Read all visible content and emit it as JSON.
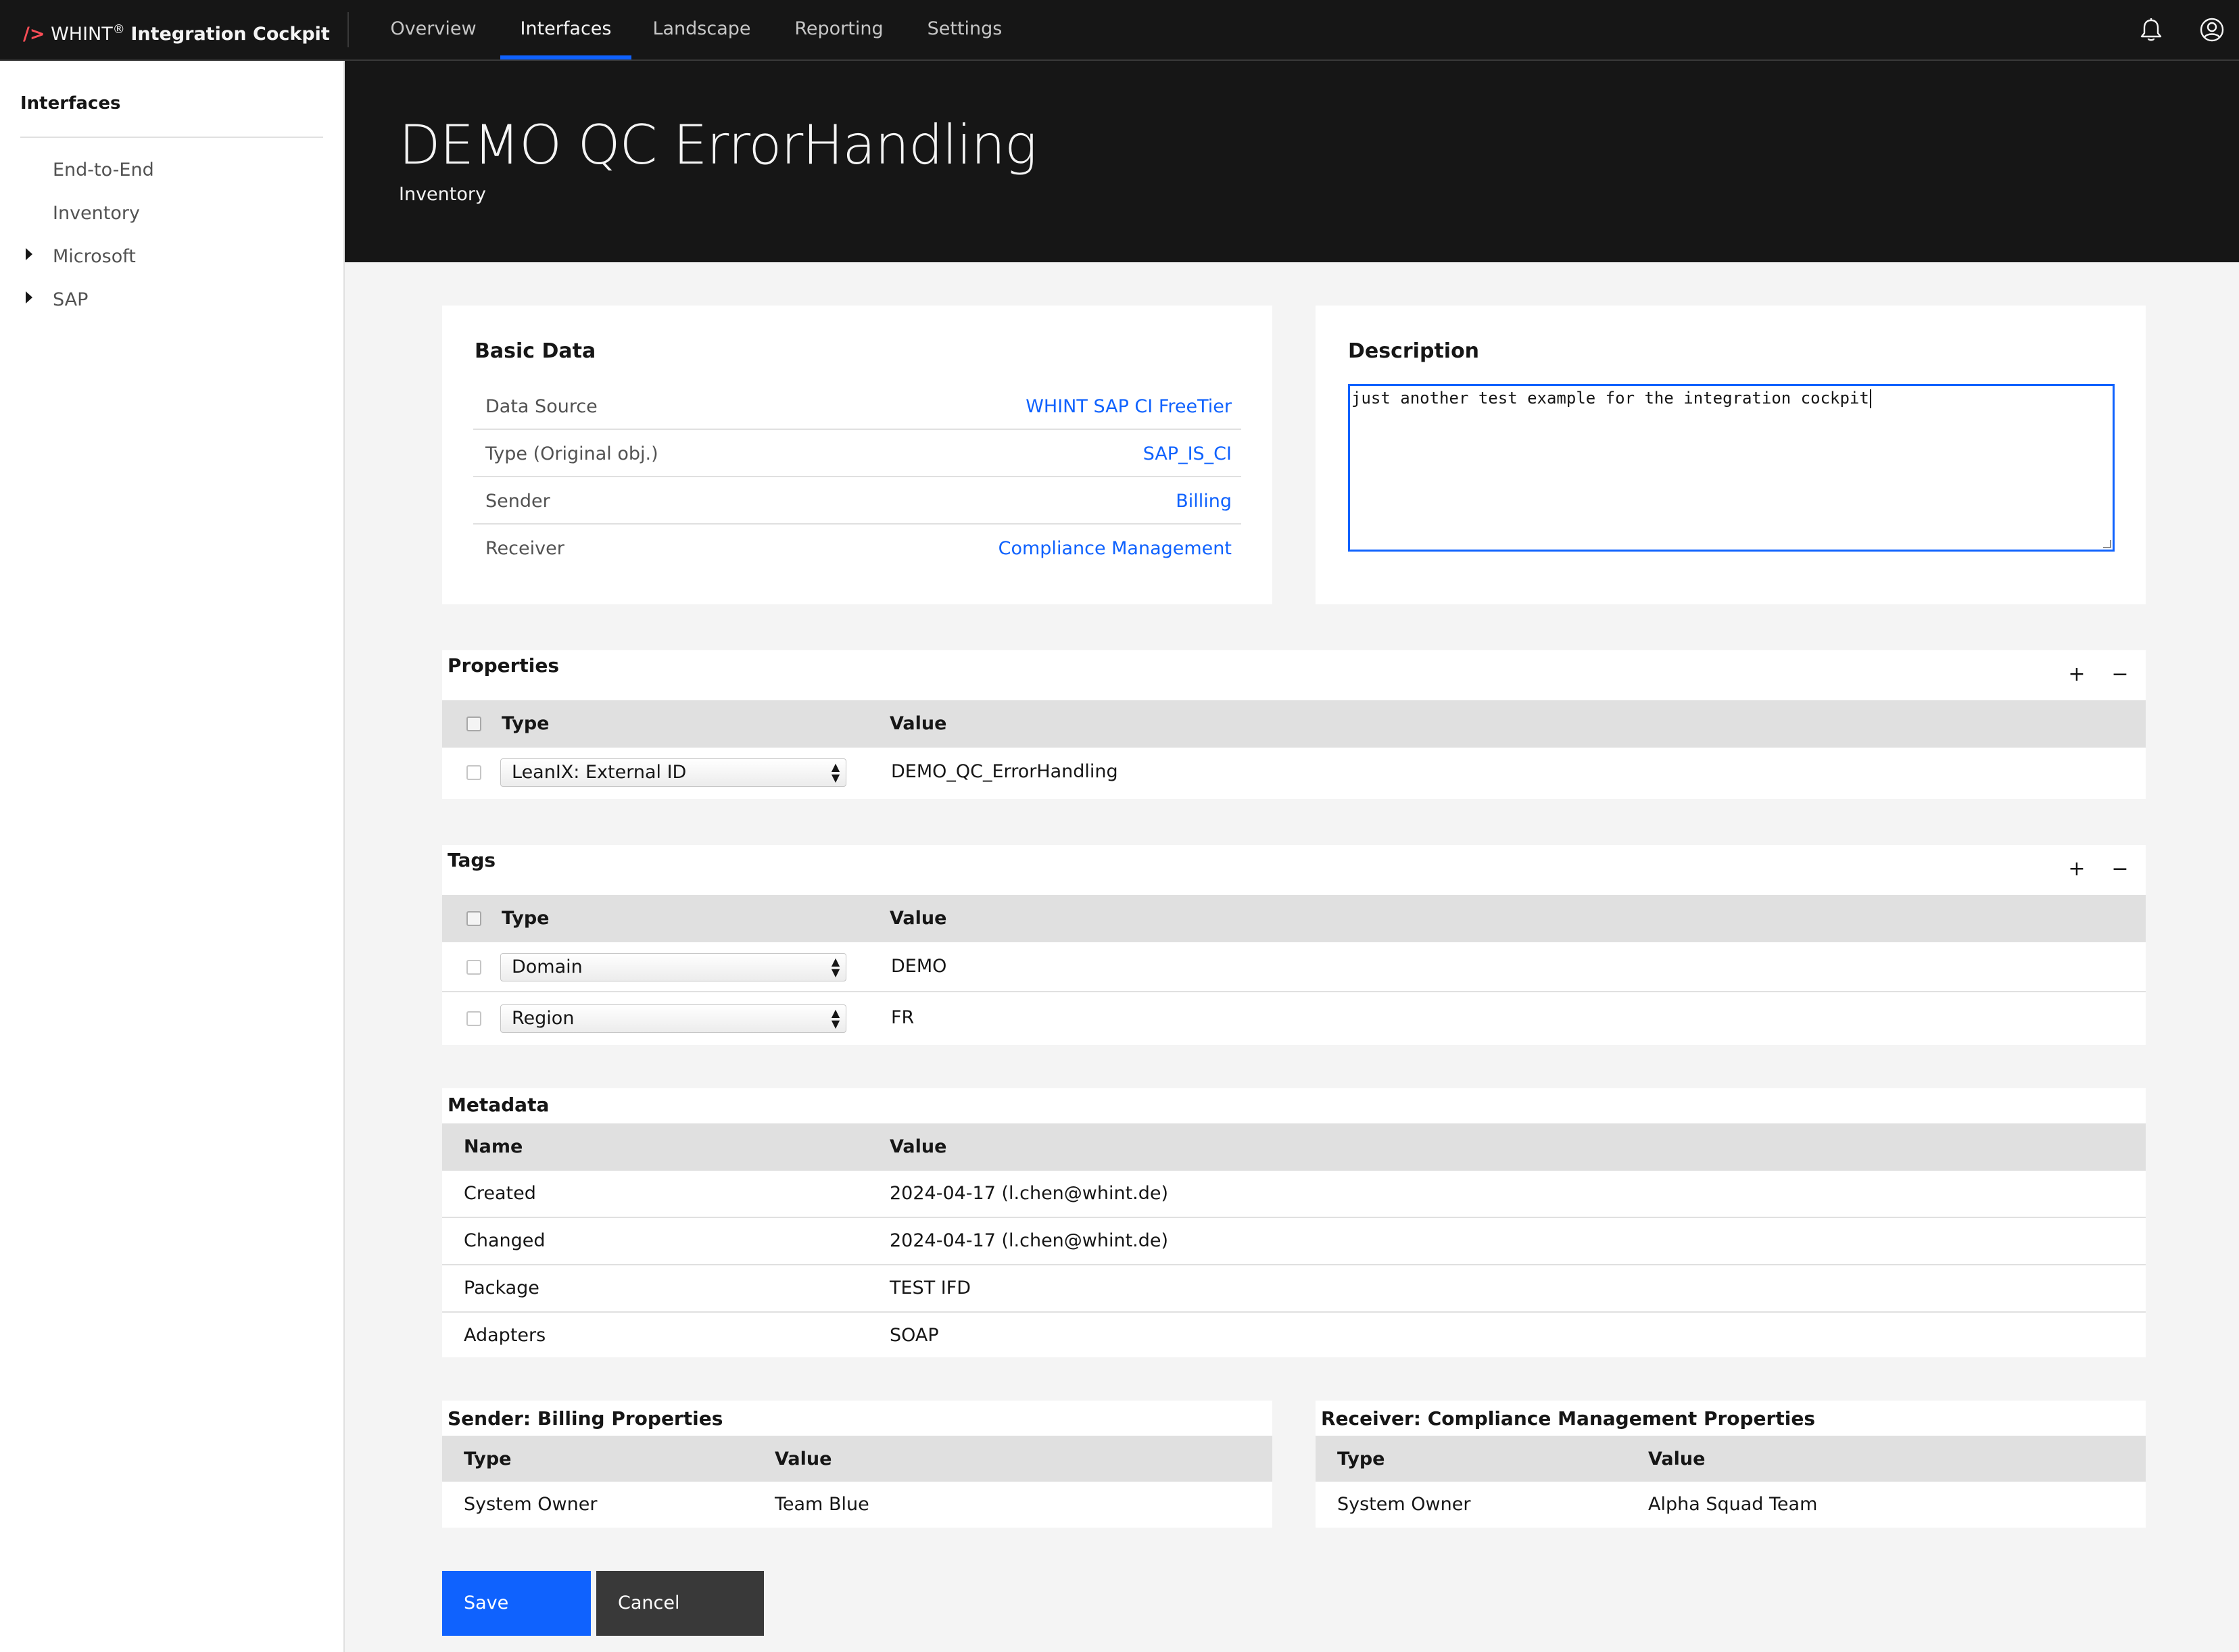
{
  "header": {
    "brand_mark": "/>",
    "brand_name": "WHINT",
    "brand_reg": "®",
    "brand_product": "Integration Cockpit",
    "nav": [
      {
        "label": "Overview"
      },
      {
        "label": "Interfaces",
        "active": true
      },
      {
        "label": "Landscape"
      },
      {
        "label": "Reporting"
      },
      {
        "label": "Settings"
      }
    ],
    "icons": [
      "bell-icon",
      "user-avatar-icon"
    ]
  },
  "sidebar": {
    "title": "Interfaces",
    "items": [
      {
        "label": "End-to-End",
        "expandable": false
      },
      {
        "label": "Inventory",
        "expandable": false
      },
      {
        "label": "Microsoft",
        "expandable": true
      },
      {
        "label": "SAP",
        "expandable": true
      }
    ]
  },
  "page": {
    "title": "DEMO QC ErrorHandling",
    "subtitle": "Inventory"
  },
  "basic_data": {
    "title": "Basic Data",
    "rows": [
      {
        "label": "Data Source",
        "value": "WHINT SAP CI FreeTier"
      },
      {
        "label": "Type (Original obj.)",
        "value": "SAP_IS_CI"
      },
      {
        "label": "Sender",
        "value": "Billing"
      },
      {
        "label": "Receiver",
        "value": "Compliance Management"
      }
    ]
  },
  "description": {
    "title": "Description",
    "value": "just another test example for the integration cockpit"
  },
  "properties": {
    "title": "Properties",
    "add": "+",
    "remove": "−",
    "columns": [
      "Type",
      "Value"
    ],
    "rows": [
      {
        "type": "LeanIX: External ID",
        "value": "DEMO_QC_ErrorHandling"
      }
    ]
  },
  "tags": {
    "title": "Tags",
    "add": "+",
    "remove": "−",
    "columns": [
      "Type",
      "Value"
    ],
    "rows": [
      {
        "type": "Domain",
        "value": "DEMO"
      },
      {
        "type": "Region",
        "value": "FR"
      }
    ]
  },
  "metadata": {
    "title": "Metadata",
    "columns": [
      "Name",
      "Value"
    ],
    "rows": [
      {
        "name": "Created",
        "value": "2024-04-17 (l.chen@whint.de)"
      },
      {
        "name": "Changed",
        "value": "2024-04-17 (l.chen@whint.de)"
      },
      {
        "name": "Package",
        "value": "TEST IFD"
      },
      {
        "name": "Adapters",
        "value": "SOAP"
      }
    ]
  },
  "sender_properties": {
    "title": "Sender: Billing Properties",
    "columns": [
      "Type",
      "Value"
    ],
    "rows": [
      {
        "type": "System Owner",
        "value": "Team Blue"
      }
    ]
  },
  "receiver_properties": {
    "title": "Receiver: Compliance Management Properties",
    "columns": [
      "Type",
      "Value"
    ],
    "rows": [
      {
        "type": "System Owner",
        "value": "Alpha Squad Team"
      }
    ]
  },
  "actions": {
    "save": "Save",
    "cancel": "Cancel"
  },
  "colors": {
    "accent": "#0f62fe",
    "header_bg": "#161616",
    "link": "#0f62fe",
    "cancel_bg": "#393939"
  }
}
